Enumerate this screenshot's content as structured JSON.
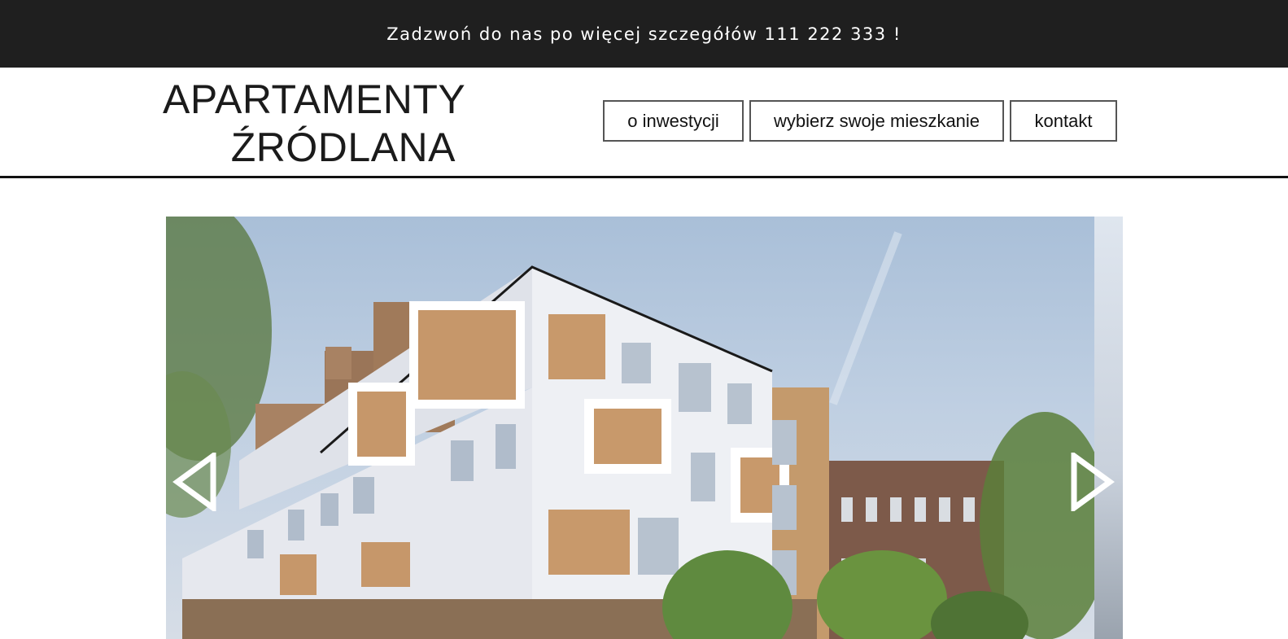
{
  "topbar": {
    "text": "Zadzwoń do nas po więcej szczegółów 111 222 333 !"
  },
  "logo": {
    "line1": "APARTAMENTY",
    "line2": "ŹRÓDLANA"
  },
  "nav": {
    "items": [
      {
        "label": "o inwestycji"
      },
      {
        "label": "wybierz swoje mieszkanie"
      },
      {
        "label": "kontakt"
      }
    ]
  },
  "slider": {
    "prev_icon": "triangle-left-outline-icon",
    "next_icon": "triangle-right-outline-icon",
    "image": "building-render"
  },
  "colors": {
    "topbar_bg": "#1f1f1f",
    "accent_text": "#111111",
    "border": "#555555"
  }
}
